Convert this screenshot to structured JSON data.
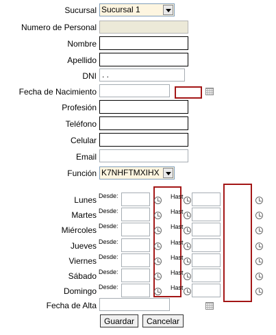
{
  "form": {
    "sucursal": {
      "label": "Sucursal",
      "value": "Sucursal 1"
    },
    "numero_personal": {
      "label": "Numero de Personal",
      "value": ""
    },
    "nombre": {
      "label": "Nombre",
      "value": ""
    },
    "apellido": {
      "label": "Apellido",
      "value": ""
    },
    "dni": {
      "label": "DNI",
      "value": ". ."
    },
    "fecha_nacimiento": {
      "label": "Fecha de Nacimiento",
      "value": ""
    },
    "profesion": {
      "label": "Profesión",
      "value": ""
    },
    "telefono": {
      "label": "Teléfono",
      "value": ""
    },
    "celular": {
      "label": "Celular",
      "value": ""
    },
    "email": {
      "label": "Email",
      "value": ""
    },
    "funcion": {
      "label": "Función",
      "value": "K7NHFTMXIHX"
    }
  },
  "schedule": {
    "desde_label": "Desde:",
    "hasta_label": "Hasta:",
    "days": [
      {
        "name": "Lunes"
      },
      {
        "name": "Martes"
      },
      {
        "name": "Miércoles"
      },
      {
        "name": "Jueves"
      },
      {
        "name": "Viernes"
      },
      {
        "name": "Sábado"
      },
      {
        "name": "Domingo"
      }
    ]
  },
  "fecha_alta": {
    "label": "Fecha de Alta",
    "value": ""
  },
  "buttons": {
    "guardar": "Guardar",
    "cancelar": "Cancelar"
  },
  "colors": {
    "highlight": "#a31515",
    "select_bg": "#fdf5e0"
  },
  "icons": {
    "calendar": "calendar-icon",
    "clock": "clock-icon",
    "dropdown": "chevron-down-icon"
  }
}
